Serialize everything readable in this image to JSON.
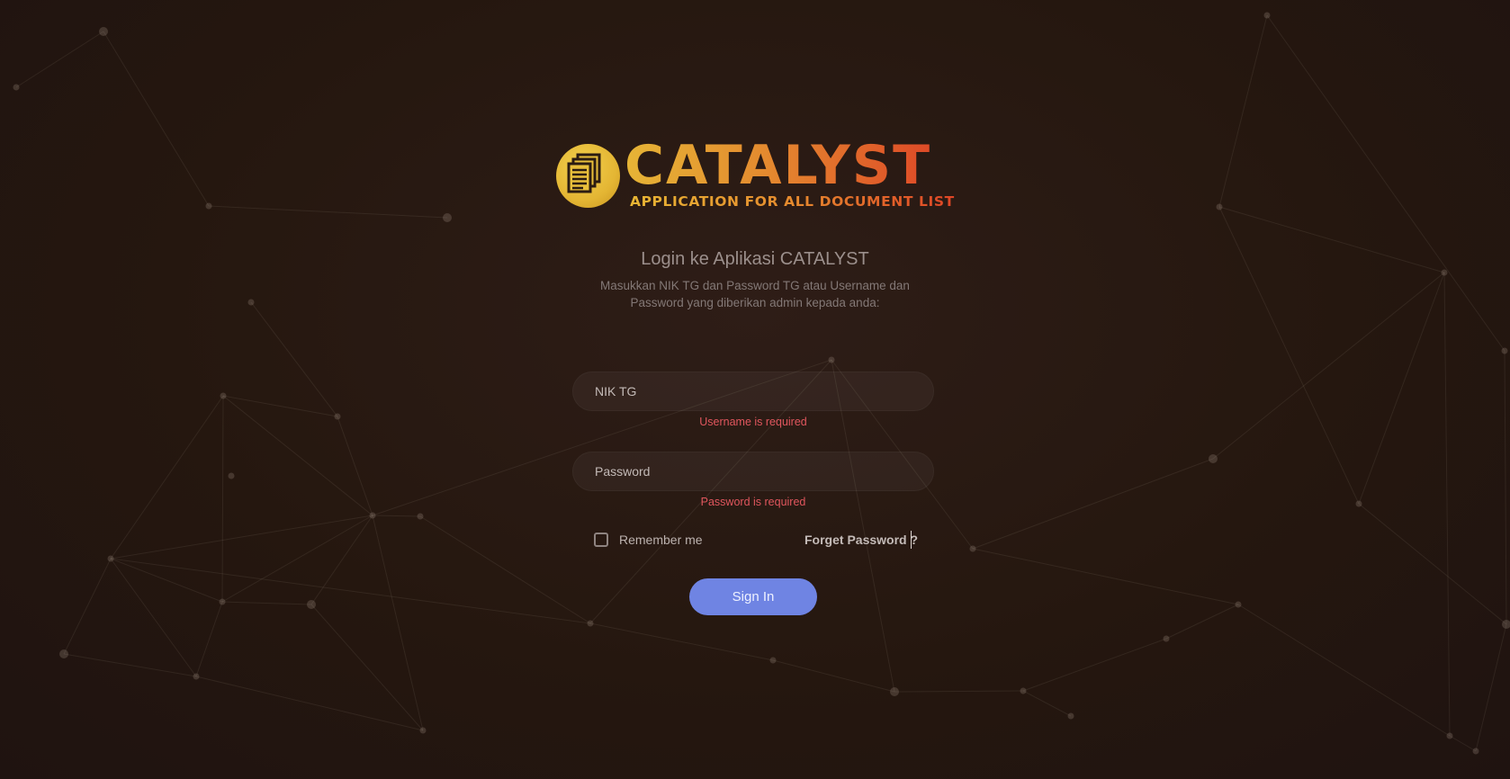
{
  "logo": {
    "icon": "stacked-documents-icon",
    "wordmark": "CATALYST",
    "tagline": "APPLICATION FOR ALL DOCUMENT LIST"
  },
  "login": {
    "heading": "Login ke Aplikasi CATALYST",
    "instructions": "Masukkan NIK TG dan Password TG atau Username dan Password yang diberikan admin kepada anda:",
    "username": {
      "placeholder": "NIK TG",
      "value": "",
      "error": "Username is required"
    },
    "password": {
      "placeholder": "Password",
      "value": "",
      "error": "Password is required"
    },
    "remember_label": "Remember me",
    "remember_checked": false,
    "forgot_label": "Forget Password ?",
    "sign_in_label": "Sign In"
  },
  "colors": {
    "background": "#25170f",
    "button": "#6f84e3",
    "error": "#e0565d",
    "logo_gold": "#e4b634",
    "logo_red": "#de4a27"
  }
}
